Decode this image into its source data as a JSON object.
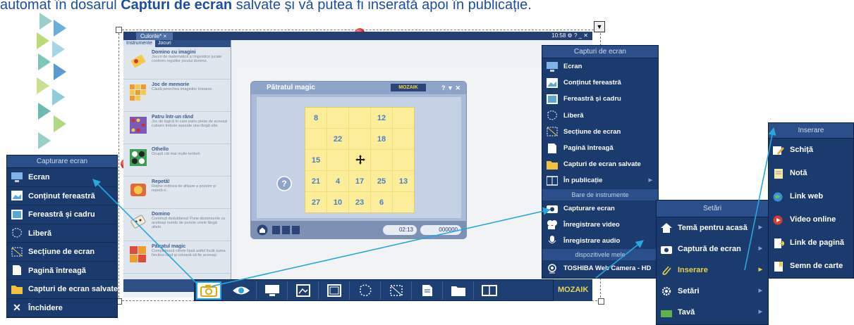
{
  "caption": {
    "before": "automat în dosarul ",
    "bold": "Capturi de ecran",
    "after": " salvate și vă putea fi inserată apoi în publicație."
  },
  "app": {
    "tab_label": "Culorile*",
    "clock": "10:58"
  },
  "sidebar": {
    "tabs": [
      "Instrumente",
      "Jocuri"
    ],
    "items": [
      {
        "title": "Domino cu imagini",
        "desc": "Jocuri de matematică și lingvistice jucate conform regulilor jocului domino."
      },
      {
        "title": "Joc de memorie",
        "desc": "Căută perechea imaginilor întoarse."
      },
      {
        "title": "Patru într-un rând",
        "desc": "Joc de logică în care patru piese de aceeași culoare trebuie așezate una lângă alta."
      },
      {
        "title": "Othello",
        "desc": "Ocupă cât mai multe teritorii."
      },
      {
        "title": "Repetă!",
        "desc": "Reține ordinea de afișare a pozelor și repetă-o."
      },
      {
        "title": "Domino",
        "desc": "Continuă dedublarea! Pune dominourile cu aceleași număr de puncte unele lângă altele."
      },
      {
        "title": "Pătratul magic",
        "desc": "Completează cifrele lipsă astfel încât suma fiecărui rând și coloană să fie aceeași."
      }
    ]
  },
  "game": {
    "title": "Pătratul magic",
    "logo": "MOZAIK",
    "cells": [
      "8",
      "",
      "",
      "12",
      "",
      "",
      "22",
      "",
      "18",
      "",
      "15",
      "",
      "",
      "",
      "",
      "21",
      "4",
      "17",
      "25",
      "13",
      "27",
      "10",
      "23",
      "6",
      ""
    ],
    "help": "?",
    "timer": "02:13",
    "score": "000000"
  },
  "toolbar_logo": "MOZAIK",
  "menu_capture_small": {
    "title": "Capturare ecran",
    "items": [
      "Ecran",
      "Conținut fereastră",
      "Fereastră și cadru",
      "Liberă",
      "Secțiune de ecran",
      "Pagină întreagă",
      "Capturi de ecran salvate",
      "Închidere"
    ]
  },
  "menu_capture_big": {
    "title": "Capturi de ecran",
    "items": [
      "Ecran",
      "Conținut fereastră",
      "Fereastră și cadru",
      "Liberă",
      "Secțiune de ecran",
      "Pagină întreagă",
      "Capturi de ecran salvate",
      "În publicație"
    ],
    "section_tools": "Bare de instrumente",
    "tools": [
      "Capturare ecran",
      "Înregistrare video",
      "Înregistrare audio"
    ],
    "section_devices": "dispozitivele mele",
    "devices": [
      "TOSHIBA Web Camera - HD"
    ]
  },
  "menu_settings": {
    "title": "Setări",
    "items": [
      "Temă pentru acasă",
      "Captură de ecran",
      "Inserare",
      "Setări",
      "Tavă"
    ]
  },
  "menu_insert": {
    "title": "Inserare",
    "items": [
      "Schiță",
      "Notă",
      "Link web",
      "Video online",
      "Link de pagină",
      "Semn de carte"
    ]
  },
  "colors": {
    "menu_bg": "#1b3a6e",
    "highlight": "#e8d243",
    "callout": "#2aa6de",
    "caption": "#1c4fa0"
  }
}
